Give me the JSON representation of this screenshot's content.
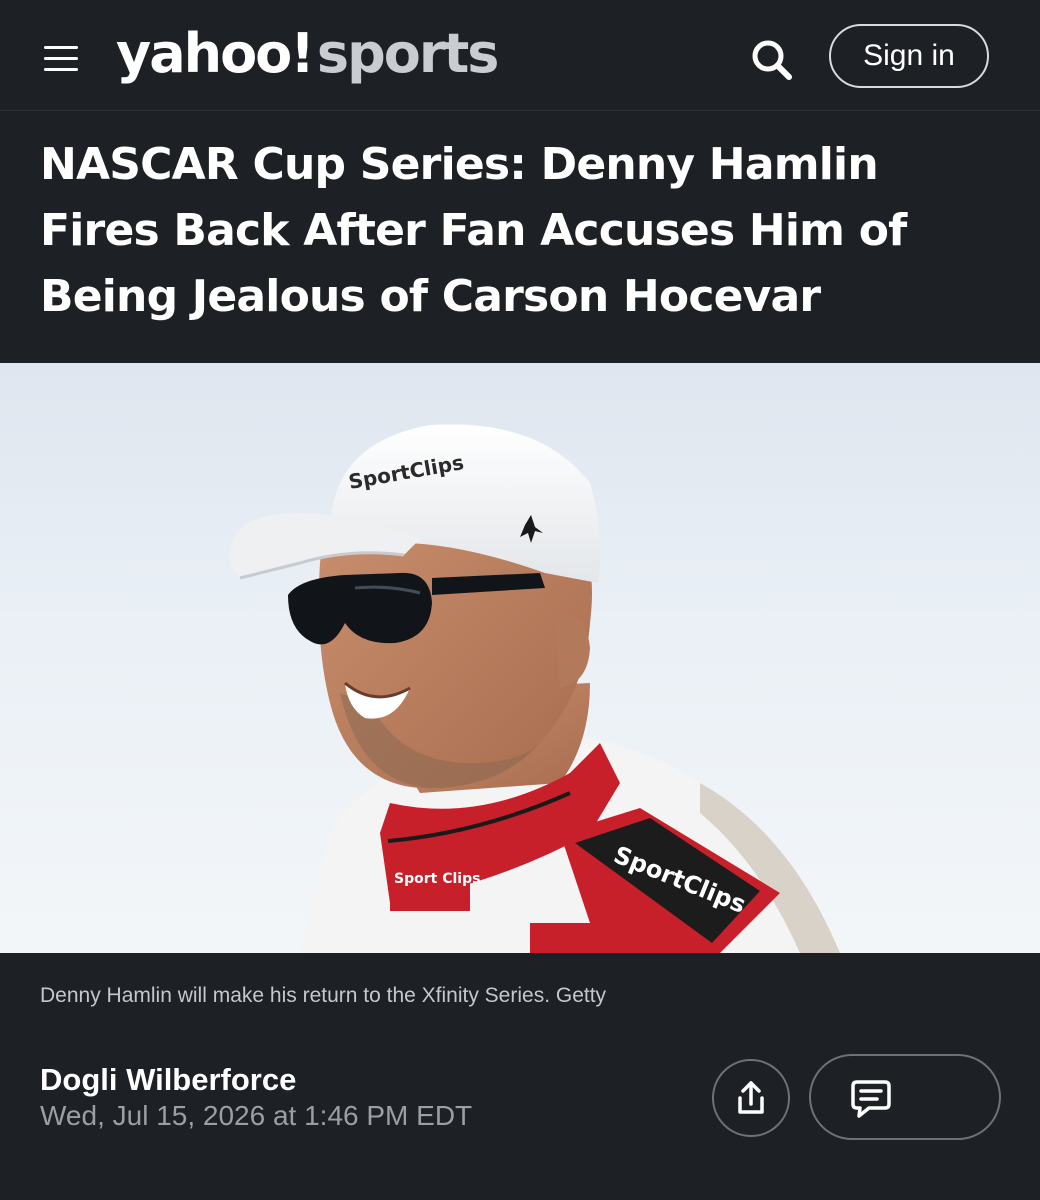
{
  "header": {
    "logo_primary": "yahoo!",
    "logo_secondary": "sports",
    "sign_in_label": "Sign in",
    "menu_icon": "hamburger-menu-icon",
    "search_icon": "search-icon"
  },
  "article": {
    "headline": "NASCAR Cup Series: Denny Hamlin Fires Back After Fan Accuses Him of Being Jealous of Carson Hocevar",
    "image": {
      "cap_brand": "SportClips",
      "suit_brand_left": "Sport Clips",
      "suit_brand_right": "SportClips"
    },
    "caption": "Denny Hamlin will make his return to the Xfinity Series. Getty",
    "author": "Dogli Wilberforce",
    "date": "Wed, Jul 15, 2026 at 1:46 PM EDT",
    "share_icon": "share-icon",
    "comments_icon": "comment-icon"
  },
  "colors": {
    "background": "#1d2024",
    "text": "#ffffff",
    "muted": "#9a9ea5",
    "suit_red": "#c8202b"
  }
}
